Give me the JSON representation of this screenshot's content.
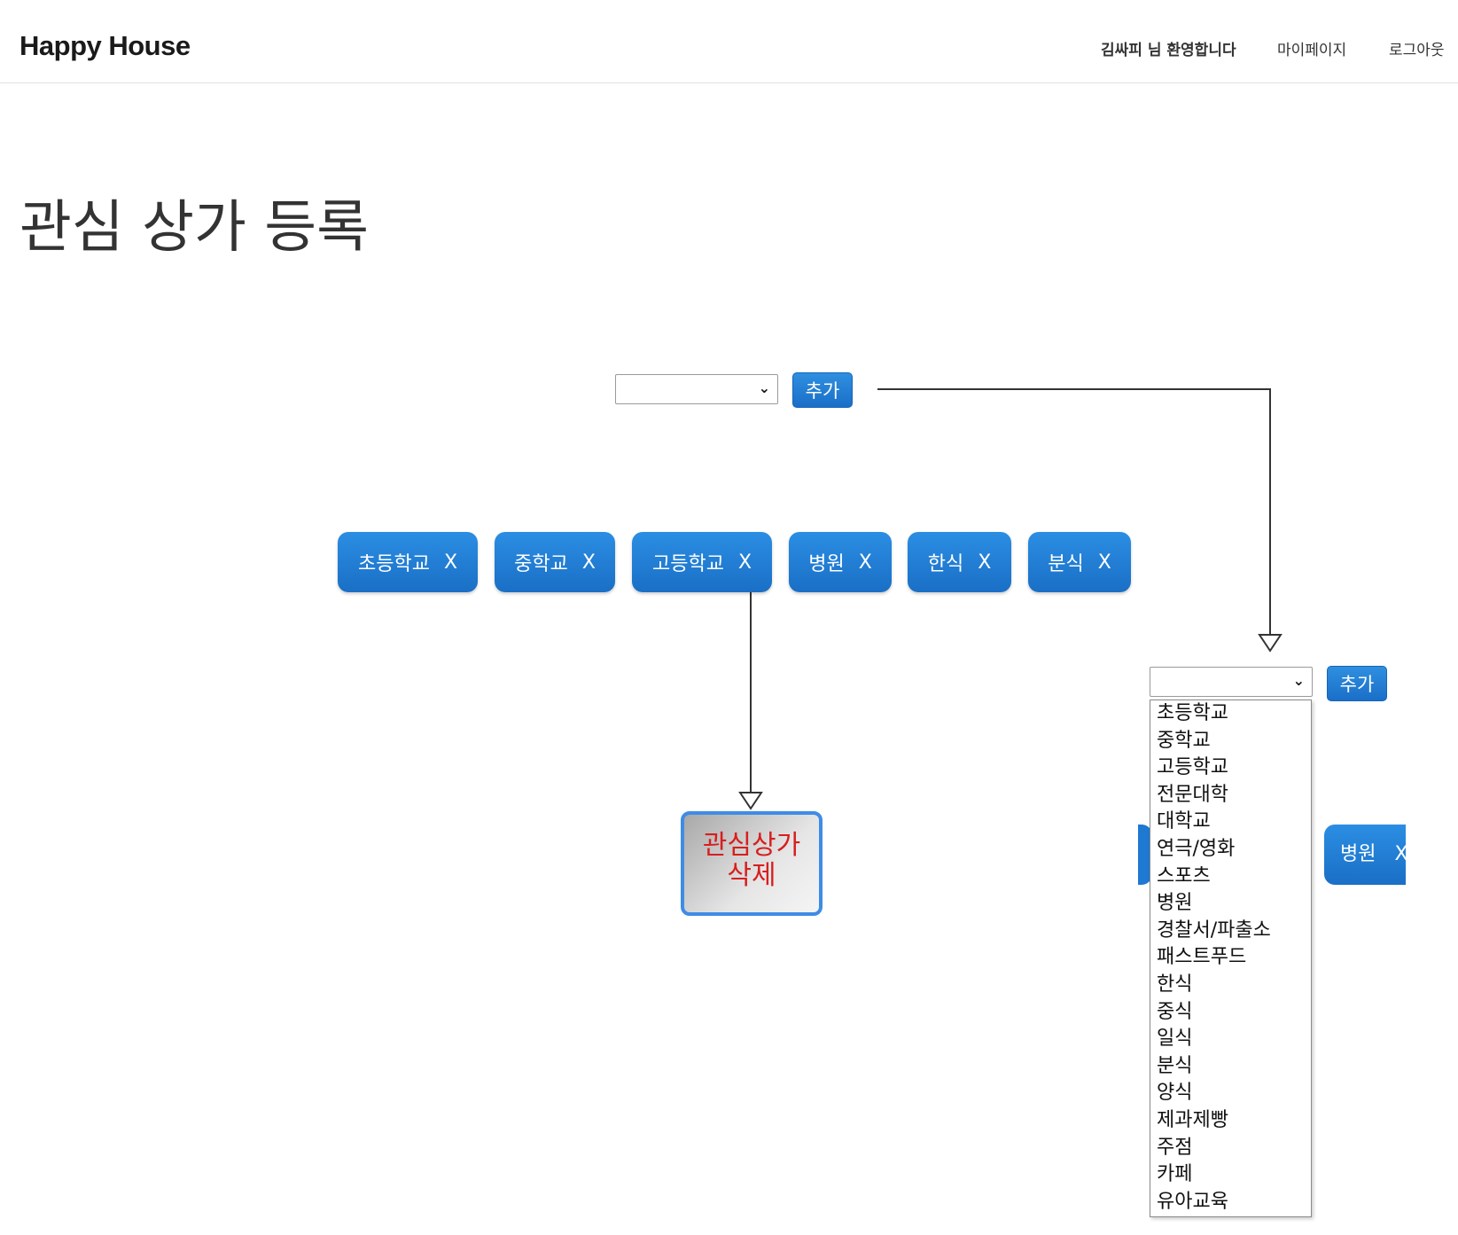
{
  "navbar": {
    "brand": "Happy House",
    "welcome": "김싸피 님 환영합니다",
    "mypage": "마이페이지",
    "logout": "로그아웃"
  },
  "page": {
    "title": "관심 상가 등록"
  },
  "top_control": {
    "add_label": "추가"
  },
  "chips": [
    {
      "label": "초등학교",
      "close": "X"
    },
    {
      "label": "중학교",
      "close": "X"
    },
    {
      "label": "고등학교",
      "close": "X"
    },
    {
      "label": "병원",
      "close": "X"
    },
    {
      "label": "한식",
      "close": "X"
    },
    {
      "label": "분식",
      "close": "X"
    }
  ],
  "delete_box": {
    "line1": "관심상가",
    "line2": "삭제"
  },
  "right_control": {
    "add_label": "추가",
    "options": [
      "초등학교",
      "중학교",
      "고등학교",
      "전문대학",
      "대학교",
      "연극/영화",
      "스포츠",
      "병원",
      "경찰서/파출소",
      "패스트푸드",
      "한식",
      "중식",
      "일식",
      "분식",
      "양식",
      "제과제빵",
      "주점",
      "카페",
      "유아교육"
    ]
  },
  "right_chip": {
    "label": "병원",
    "close": "X"
  },
  "colors": {
    "chip_blue": "#1a6fc6",
    "delete_text": "#d81e1e",
    "delete_border": "#3f8ce6"
  }
}
